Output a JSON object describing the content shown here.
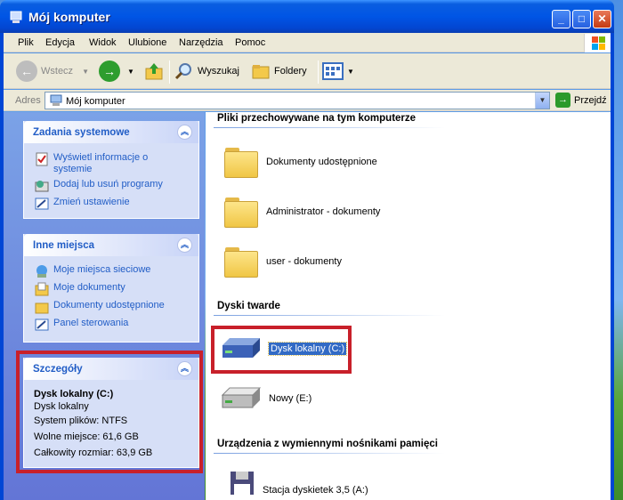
{
  "window": {
    "title": "Mój komputer"
  },
  "menu": [
    "Plik",
    "Edycja",
    "Widok",
    "Ulubione",
    "Narzędzia",
    "Pomoc"
  ],
  "toolbar": {
    "back": "Wstecz",
    "search": "Wyszukaj",
    "folders": "Foldery"
  },
  "address": {
    "label": "Adres",
    "value": "Mój komputer",
    "go": "Przejdź"
  },
  "tasks": {
    "title": "Zadania systemowe",
    "items": [
      "Wyświetl informacje o systemie",
      "Dodaj lub usuń programy",
      "Zmień ustawienie"
    ]
  },
  "places": {
    "title": "Inne miejsca",
    "items": [
      "Moje miejsca sieciowe",
      "Moje dokumenty",
      "Dokumenty udostępnione",
      "Panel sterowania"
    ]
  },
  "details": {
    "title": "Szczegóły",
    "name": "Dysk lokalny (C:)",
    "type": "Dysk lokalny",
    "fs": "System plików: NTFS",
    "free": "Wolne miejsce: 61,6 GB",
    "total": "Całkowity rozmiar: 63,9 GB"
  },
  "content": {
    "group_files": "Pliki przechowywane na tym komputerze",
    "folders": [
      "Dokumenty udostępnione",
      "Administrator - dokumenty",
      "user - dokumenty"
    ],
    "group_disks": "Dyski twarde",
    "disks": [
      "Dysk lokalny (C:)",
      "Nowy (E:)"
    ],
    "group_removable": "Urządzenia z wymiennymi nośnikami pamięci",
    "removable": [
      "Stacja dyskietek 3,5 (A:)"
    ]
  },
  "colors": {
    "accent": "#215dc6",
    "highlight": "#c8202a",
    "selection": "#316ac5"
  }
}
